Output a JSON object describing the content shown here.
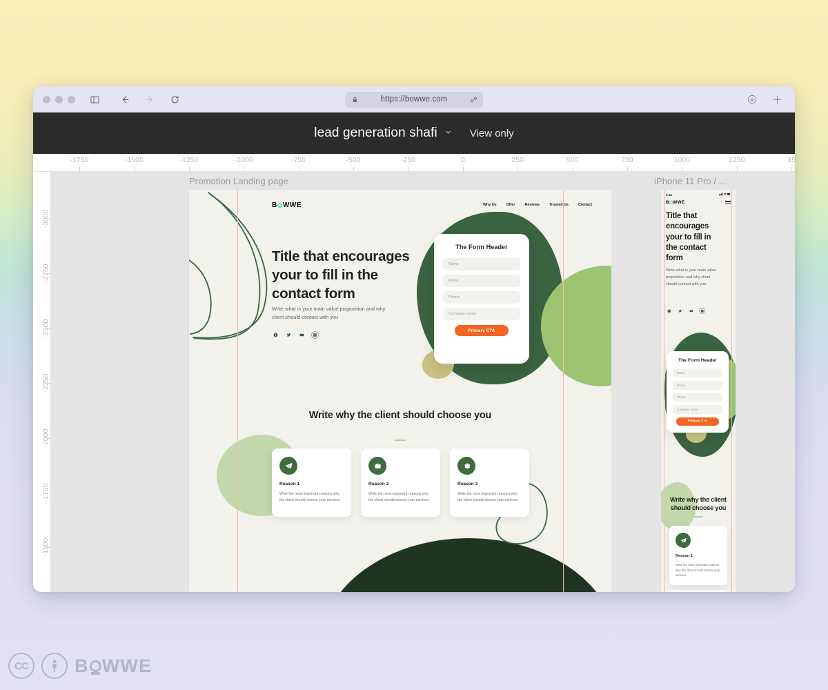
{
  "browser": {
    "url": "https://bowwe.com",
    "icons": {
      "lock": "lock-icon",
      "link": "link-icon",
      "sidebar": "sidebar-toggle-icon",
      "back": "back-arrow-icon",
      "forward": "forward-arrow-icon",
      "reload": "reload-icon",
      "download": "download-icon",
      "new_tab": "plus-icon"
    }
  },
  "app_header": {
    "title": "lead generation shafi",
    "chevron": "⌄",
    "view_only": "View only"
  },
  "rulers": {
    "horizontal": [
      "-1750",
      "-1500",
      "-1250",
      "-1000",
      "-750",
      "-500",
      "-250",
      "0",
      "250",
      "500",
      "750",
      "1000",
      "1250",
      "15"
    ],
    "vertical": [
      "-3000",
      "-2750",
      "-2500",
      "-2250",
      "-2000",
      "-1750",
      "-1500"
    ]
  },
  "desktop_board": {
    "label": "Promotion Landing page",
    "logo": "BOWWE",
    "nav": [
      "Why Us",
      "Offer",
      "Reviews",
      "Trusted Us",
      "Contact"
    ],
    "hero": {
      "title": "Title that encourages your to fill in the contact form",
      "subtitle": "Write what is your main value proposition and why client should contact with you",
      "socials": [
        "facebook-icon",
        "twitter-icon",
        "youtube-icon",
        "instagram-icon"
      ]
    },
    "form": {
      "header": "The Form Header",
      "fields": [
        "Name",
        "Email",
        "Phone",
        "Company name"
      ],
      "cta": "Primary CTA"
    },
    "reasons": {
      "title": "Write why the client should choose you",
      "cards": [
        {
          "icon": "paper-plane-icon",
          "title": "Reason 1",
          "body": "Write the most important reasons why the client should choose your services"
        },
        {
          "icon": "briefcase-icon",
          "title": "Reason 2",
          "body": "Write the most important reasons why the client should choose your services"
        },
        {
          "icon": "gear-icon",
          "title": "Reason 3",
          "body": "Write the most important reasons why the client should choose your services"
        }
      ]
    }
  },
  "mobile_board": {
    "label": "iPhone 11 Pro / ...",
    "status_time": "9:41",
    "logo": "BOWWE",
    "hero": {
      "title": "Title that encourages your to fill in the contact form",
      "subtitle": "Write what is your main value proposition and why client should contact with you",
      "socials": [
        "facebook-icon",
        "twitter-icon",
        "youtube-icon",
        "instagram-icon"
      ]
    },
    "form": {
      "header": "The Form Header",
      "fields": [
        "Name",
        "Email",
        "Phone",
        "Company name"
      ],
      "cta": "Primary CTA"
    },
    "reasons": {
      "title": "Write why the client should choose you",
      "cards": [
        {
          "icon": "paper-plane-icon",
          "title": "Reason 1",
          "body": "Write the most important reasons why the client should choose your services"
        }
      ]
    }
  },
  "watermark": {
    "cc": "CC",
    "by": "person-icon",
    "brand": "B",
    "brand_rest": "WWE"
  },
  "colors": {
    "accent_orange": "#f26522",
    "dark_green": "#3a6340",
    "light_green": "#9cc572",
    "sage": "#c2d7aa",
    "olive": "#c9c283",
    "deep_green": "#1f3521",
    "header_dark": "#2b2b2b",
    "guide_pink": "#f4b9ab"
  }
}
